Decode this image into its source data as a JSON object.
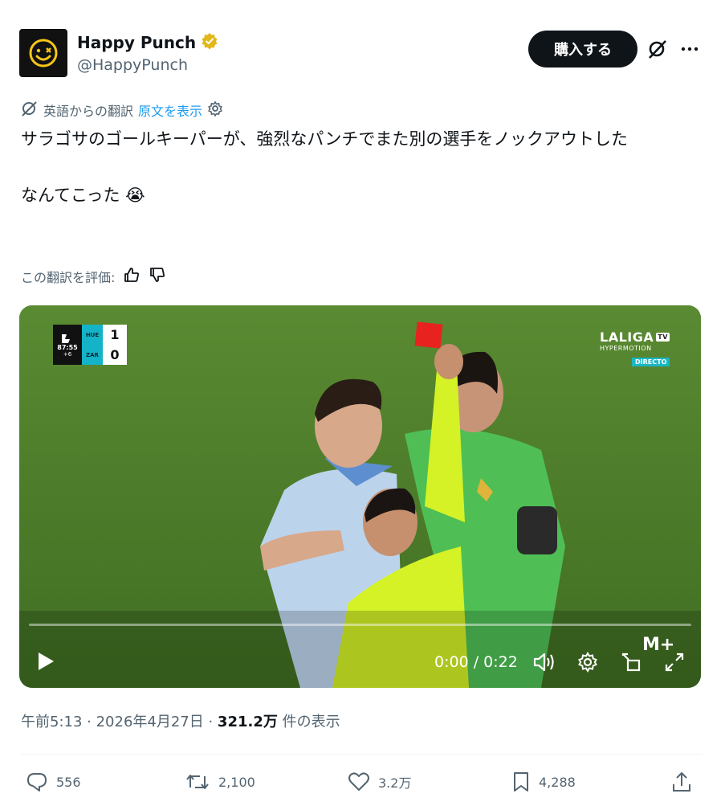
{
  "header": {
    "display_name": "Happy Punch",
    "handle": "@HappyPunch",
    "buy_label": "購入する"
  },
  "translation": {
    "source_label": "英語からの翻訳",
    "show_original": "原文を表示"
  },
  "tweet": {
    "text": "サラゴサのゴールキーパーが、強烈なパンチでまた別の選手をノックアウトした\n\nなんてこった 😭"
  },
  "rating": {
    "label": "この翻訳を評価:"
  },
  "video": {
    "scoreboard": {
      "clock": "87:55",
      "added": "+6",
      "home_team": "HUE",
      "away_team": "ZAR",
      "home_score": "1",
      "away_score": "0"
    },
    "broadcaster": {
      "name": "LALIGA",
      "tv": "TV",
      "sub": "HYPERMOTION",
      "live": "DIRECTO"
    },
    "sponsor_mark": "M+",
    "time": "0:00 / 0:22",
    "progress": 0
  },
  "meta": {
    "time": "午前5:13 · 2026年4月27日 · ",
    "views": "321.2万",
    "views_suffix": " 件の表示"
  },
  "actions": {
    "replies": "556",
    "reposts": "2,100",
    "likes": "3.2万",
    "bookmarks": "4,288"
  },
  "colors": {
    "accent": "#1d9bf0",
    "verified": "#e2b719",
    "text": "#0f1419",
    "muted": "#536471"
  }
}
